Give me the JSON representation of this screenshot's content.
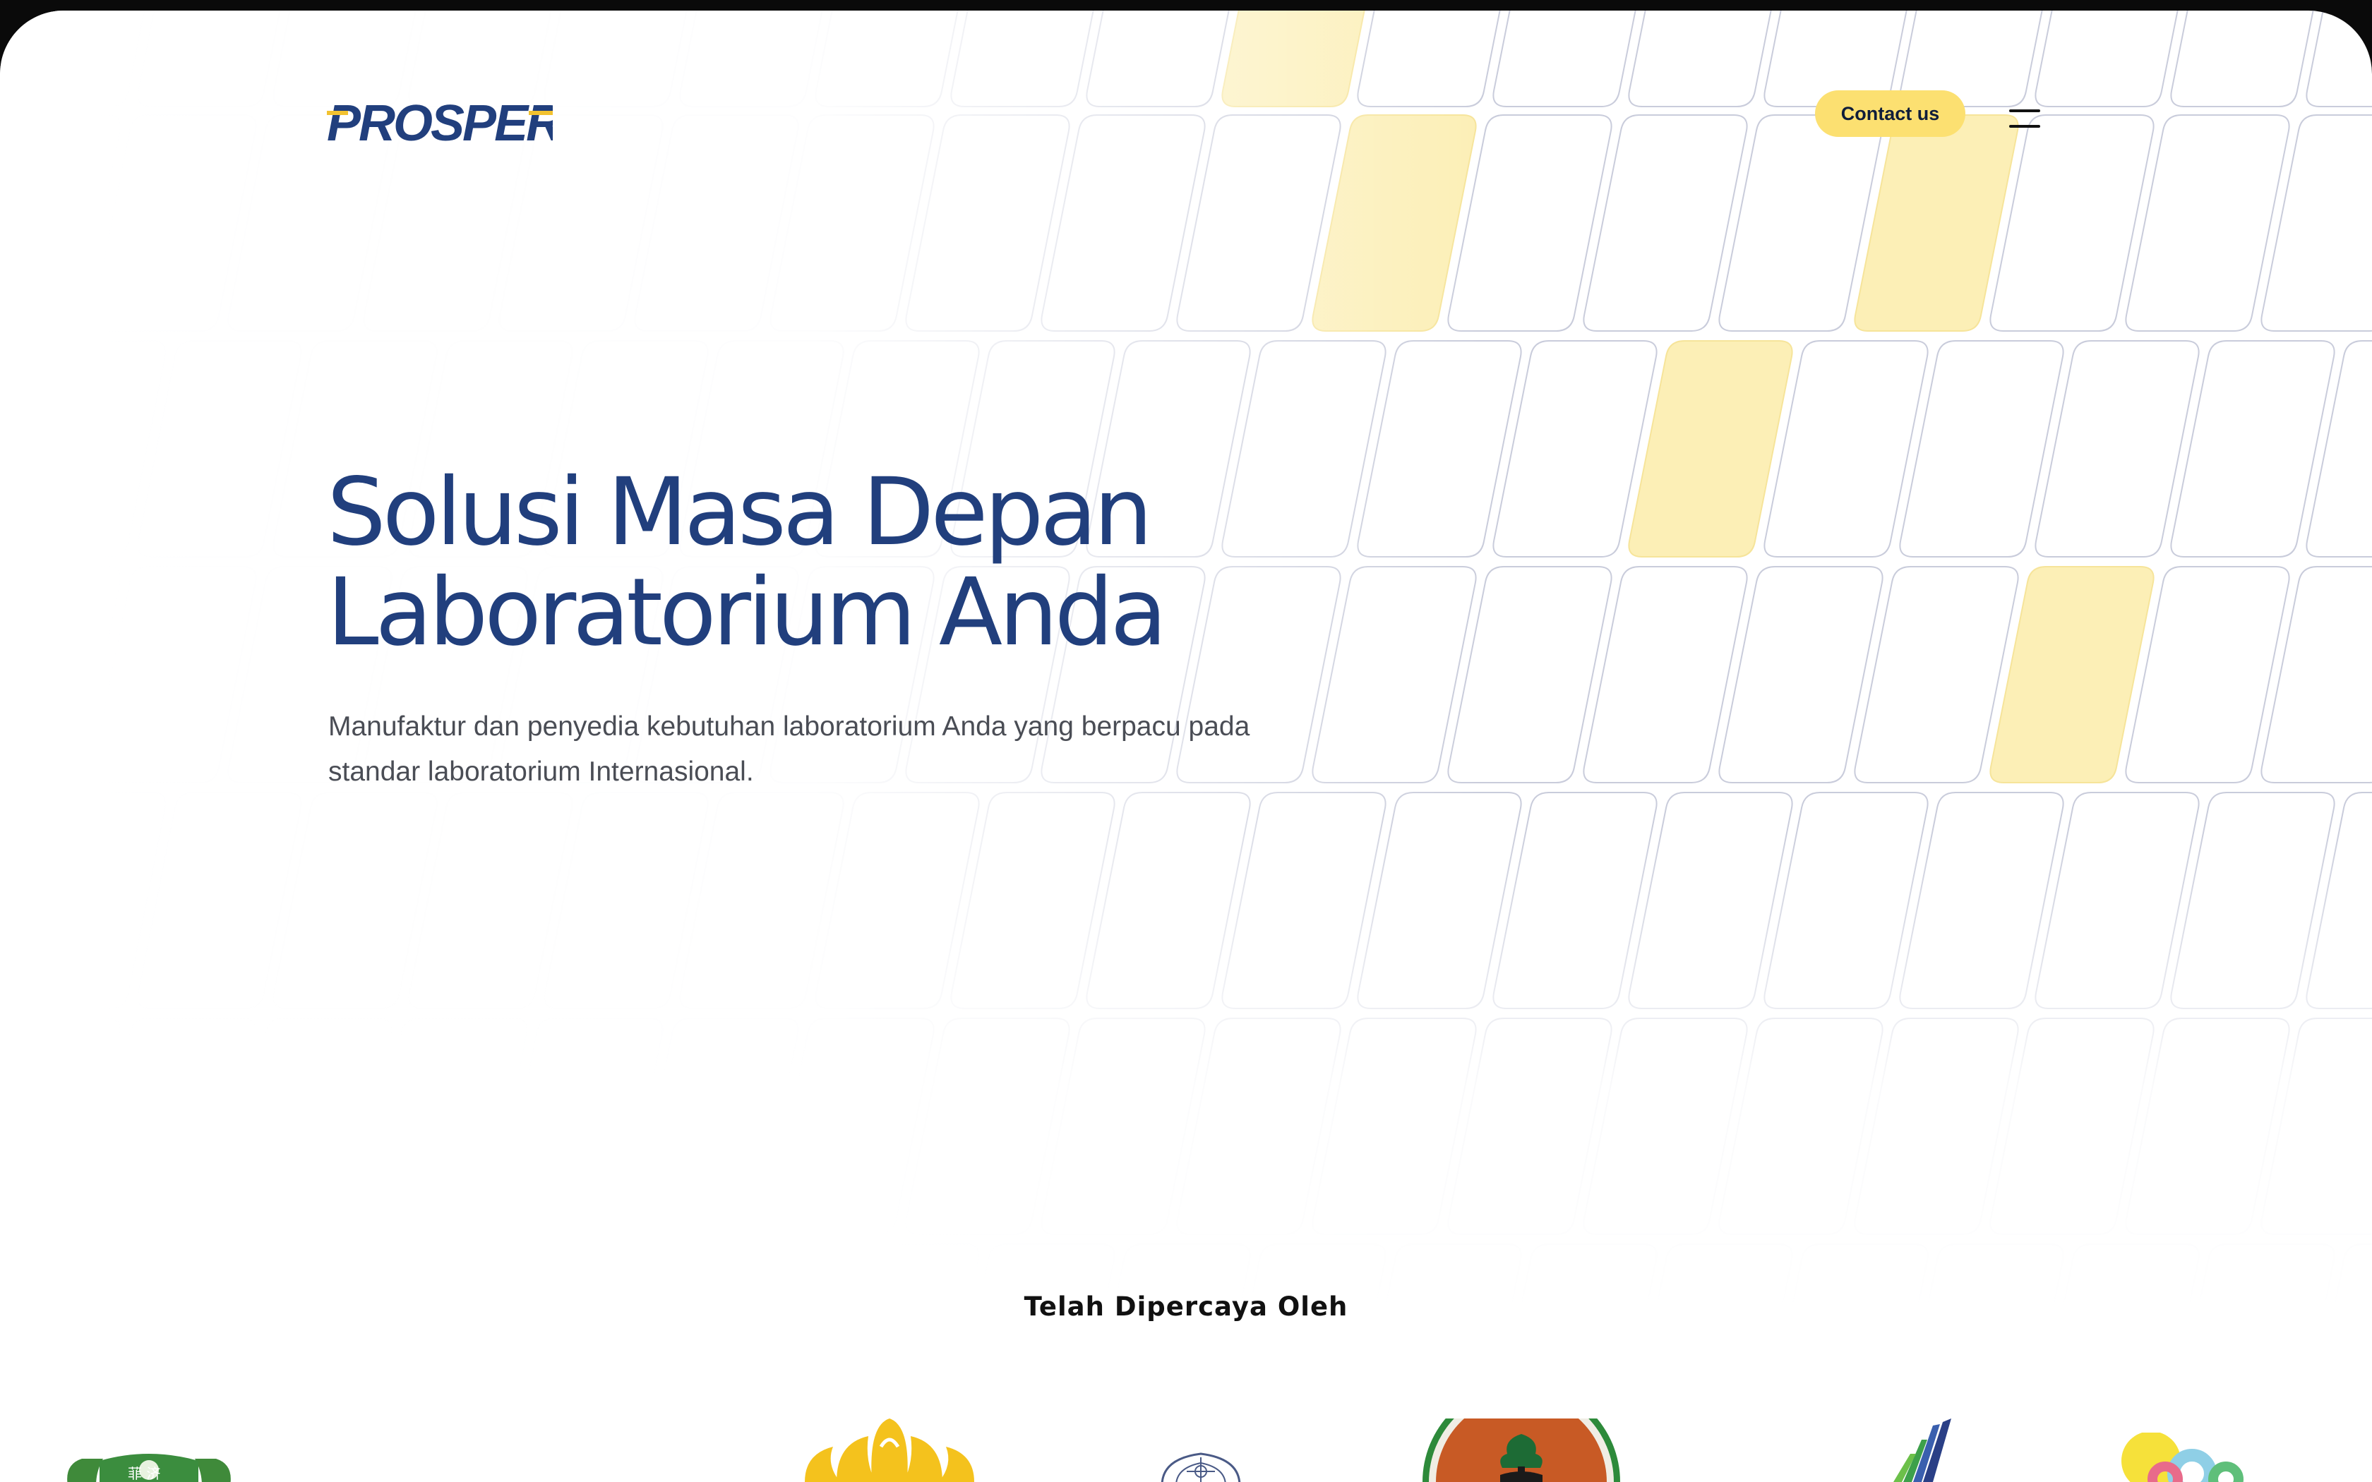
{
  "header": {
    "logo_text": "PROSPERA",
    "contact_label": "Contact us",
    "menu_icon": "hamburger-menu-icon"
  },
  "hero": {
    "title_line1": "Solusi Masa Depan",
    "title_line2": "Laboratorium Anda",
    "subtitle_line1": "Manufaktur dan penyedia kebutuhan laboratorium Anda yang berpacu pada",
    "subtitle_line2": "standar laboratorium Internasional."
  },
  "trusted": {
    "heading": "Telah Dipercaya Oleh",
    "logos": [
      "green-shield-logo",
      "yellow-wing-emblem-logo",
      "navy-crest-logo",
      "orange-round-seal-logo",
      "blue-green-stripes-logo",
      "colorful-circles-logo"
    ]
  },
  "colors": {
    "brand_navy": "#213f7d",
    "brand_yellow": "#fce071",
    "tile_yellow": "#fcefb6",
    "grid_line": "#c9ccdb"
  }
}
